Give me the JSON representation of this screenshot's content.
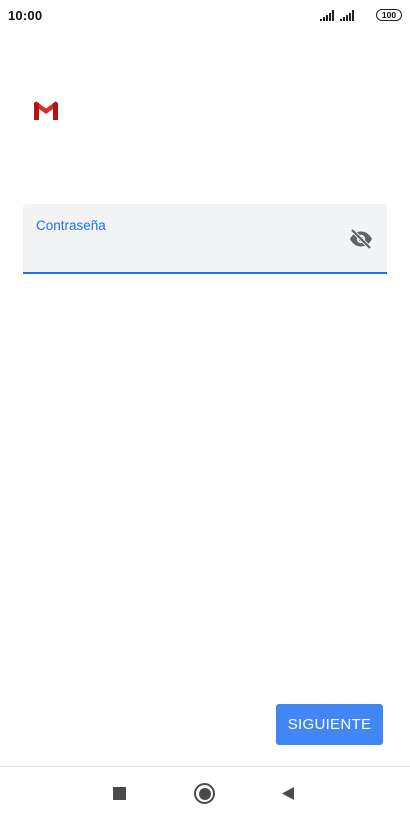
{
  "status_bar": {
    "time": "10:00",
    "battery": "100",
    "icons": [
      "signal-icon",
      "signal-icon",
      "battery-icon"
    ]
  },
  "app": {
    "logo_icon": "gmail-logo-icon",
    "brand_colors": {
      "red": "#d93025",
      "dark_red": "#b31412"
    }
  },
  "password_field": {
    "label": "Contraseña",
    "value": "",
    "toggle_icon": "visibility-off-icon",
    "accent_color": "#1a73e8"
  },
  "actions": {
    "next_label": "SIGUIENTE",
    "next_color": "#4285f4"
  },
  "nav_bar": {
    "icons": [
      "recents-square-icon",
      "home-circle-icon",
      "back-triangle-icon"
    ]
  }
}
